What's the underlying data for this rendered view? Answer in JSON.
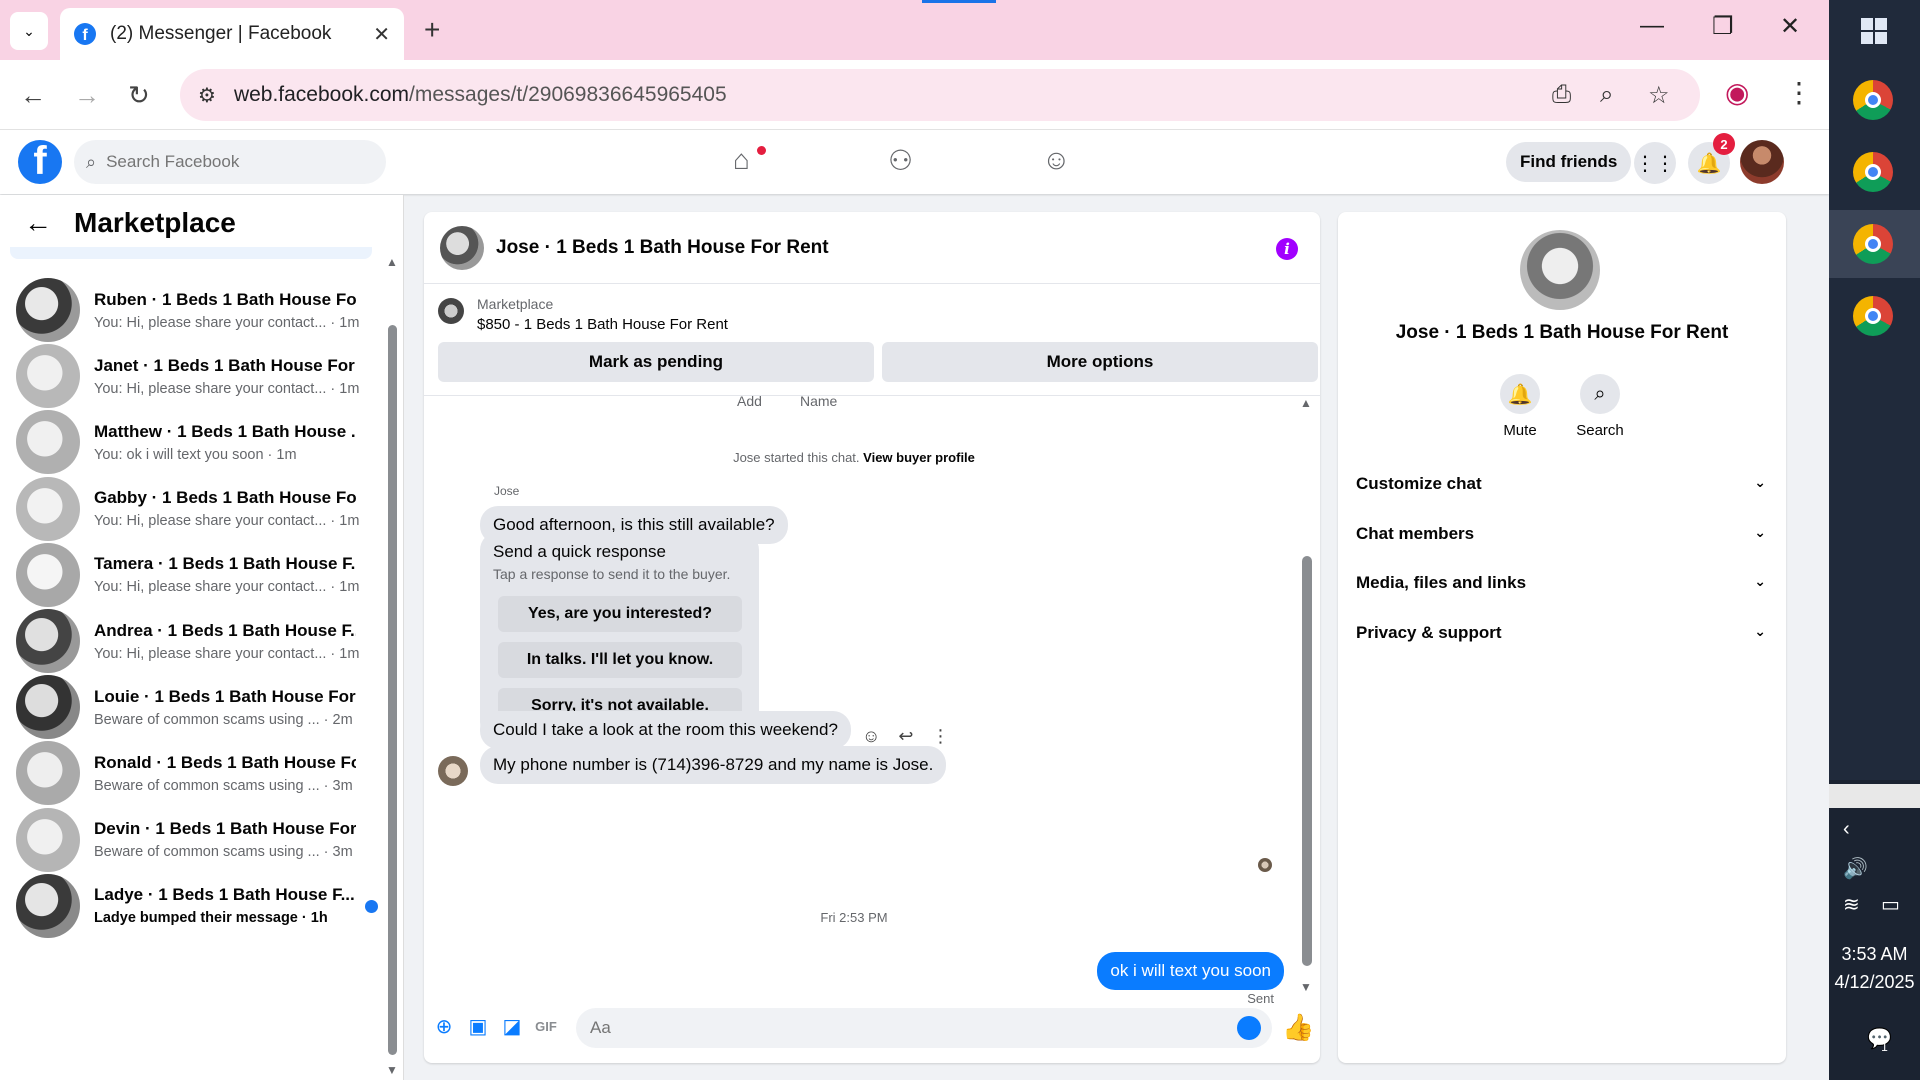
{
  "browser": {
    "tab_title": "(2) Messenger | Facebook",
    "url_domain": "web.facebook.com",
    "url_path": "/messages/t/29069836645965405"
  },
  "header": {
    "search_placeholder": "Search Facebook",
    "find_friends": "Find friends",
    "notification_count": "2"
  },
  "sidebar": {
    "title": "Marketplace",
    "conversations": [
      {
        "name": "Ruben · 1 Beds 1 Bath House Fo...",
        "preview": "You: Hi, please share your contact... · 1m",
        "unread": false
      },
      {
        "name": "Janet · 1 Beds 1 Bath House For ...",
        "preview": "You: Hi, please share your contact... · 1m",
        "unread": false
      },
      {
        "name": "Matthew · 1 Beds 1 Bath House ...",
        "preview": "You: ok i will text you soon · 1m",
        "unread": false
      },
      {
        "name": "Gabby · 1 Beds 1 Bath House Fo...",
        "preview": "You: Hi, please share your contact... · 1m",
        "unread": false
      },
      {
        "name": "Tamera · 1 Beds 1 Bath House F...",
        "preview": "You: Hi, please share your contact... · 1m",
        "unread": false
      },
      {
        "name": "Andrea · 1 Beds 1 Bath House F...",
        "preview": "You: Hi, please share your contact... · 1m",
        "unread": false
      },
      {
        "name": "Louie · 1 Beds 1 Bath House For ...",
        "preview": "Beware of common scams using ... · 2m",
        "unread": false
      },
      {
        "name": "Ronald · 1 Beds 1 Bath House Fo...",
        "preview": "Beware of common scams using ... · 3m",
        "unread": false
      },
      {
        "name": "Devin · 1 Beds 1 Bath House For...",
        "preview": "Beware of common scams using ... · 3m",
        "unread": false
      },
      {
        "name": "Ladye · 1 Beds 1 Bath House F...",
        "preview": "Ladye bumped their message · 1h",
        "unread": true
      }
    ]
  },
  "chat": {
    "title": "Jose · 1 Beds 1 Bath House For Rent",
    "marketplace_label": "Marketplace",
    "listing": "$850 - 1 Beds 1 Bath House For Rent",
    "mark_pending": "Mark as pending",
    "more_options": "More options",
    "cut_text_1": "Add",
    "cut_text_2": "Name",
    "started_text": "Jose started this chat.",
    "view_profile": "View buyer profile",
    "sender_name": "Jose",
    "messages": {
      "m1": "Good afternoon, is this still available?",
      "m2": "Could I take a look at the room this weekend?",
      "m3": "My phone number is (714)396-8729 and my name is Jose.",
      "out1": "ok i will text you soon"
    },
    "quick_response": {
      "title": "Send a quick response",
      "subtitle": "Tap a response to send it to the buyer.",
      "options": [
        "Yes, are you interested?",
        "In talks. I'll let you know.",
        "Sorry, it's not available."
      ]
    },
    "timestamp": "Fri 2:53 PM",
    "sent_status": "Sent",
    "input_placeholder": "Aa"
  },
  "details": {
    "name": "Jose · 1 Beds 1 Bath House For Rent",
    "mute": "Mute",
    "search": "Search",
    "sections": [
      "Customize chat",
      "Chat members",
      "Media, files and links",
      "Privacy & support"
    ]
  },
  "taskbar": {
    "time": "3:53 AM",
    "date": "4/12/2025",
    "notif_count": "1"
  }
}
